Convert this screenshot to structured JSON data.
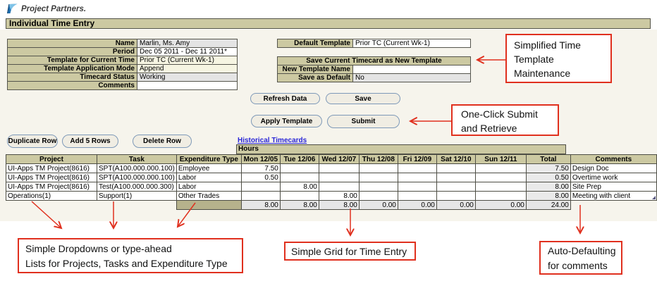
{
  "brand": {
    "name": "Project Partners.",
    "icon": "pennant-logo-icon"
  },
  "page": {
    "title": "Individual Time Entry"
  },
  "details_form": {
    "rows": [
      {
        "label": "Name",
        "value": "Marlin, Ms. Amy"
      },
      {
        "label": "Period",
        "value": "Dec 05 2011 - Dec 11 2011*"
      },
      {
        "label": "Template for Current Time",
        "value": "Prior TC (Current Wk-1)"
      },
      {
        "label": "Template Application Mode",
        "value": "Append"
      },
      {
        "label": "Timecard Status",
        "value": "Working"
      },
      {
        "label": "Comments",
        "value": ""
      }
    ]
  },
  "template_form": {
    "default_template_label": "Default Template",
    "default_template_value": "Prior TC (Current Wk-1)",
    "section_title": "Save Current Timecard as New Template",
    "new_template_label": "New Template Name",
    "new_template_value": "",
    "save_default_label": "Save as Default",
    "save_default_value": "No"
  },
  "actions": {
    "refresh": "Refresh Data",
    "save": "Save",
    "apply": "Apply Template",
    "submit": "Submit"
  },
  "row_actions": {
    "duplicate": "Duplicate Row",
    "add5": "Add 5 Rows",
    "delete": "Delete Row"
  },
  "link": {
    "historical": "Historical Timecards"
  },
  "timecard": {
    "hours_label": "Hours",
    "columns": [
      "Project",
      "Task",
      "Expenditure Type"
    ],
    "day_columns": [
      "Mon 12/05",
      "Tue 12/06",
      "Wed 12/07",
      "Thu 12/08",
      "Fri 12/09",
      "Sat 12/10",
      "Sun 12/11"
    ],
    "total_label": "Total",
    "comments_label": "Comments",
    "rows": [
      {
        "project": "UI-Apps TM Project(8616)",
        "task": "SPT(A100.000.000.100)",
        "expenditure_type": "Employee",
        "hours": [
          "7.50",
          "",
          "",
          "",
          "",
          "",
          ""
        ],
        "total": "7.50",
        "comments": "Design Doc"
      },
      {
        "project": "UI-Apps TM Project(8616)",
        "task": "SPT(A100.000.000.100)",
        "expenditure_type": "Labor",
        "hours": [
          "0.50",
          "",
          "",
          "",
          "",
          "",
          ""
        ],
        "total": "0.50",
        "comments": "Overtime work"
      },
      {
        "project": "UI-Apps TM Project(8616)",
        "task": "Test(A100.000.000.300)",
        "expenditure_type": "Labor",
        "hours": [
          "",
          "8.00",
          "",
          "",
          "",
          "",
          ""
        ],
        "total": "8.00",
        "comments": "Site Prep"
      },
      {
        "project": "Operations(1)",
        "task": "Support(1)",
        "expenditure_type": "Other Trades",
        "hours": [
          "",
          "",
          "8.00",
          "",
          "",
          "",
          ""
        ],
        "total": "8.00",
        "comments": "Meeting with client"
      }
    ],
    "totals": {
      "hours": [
        "8.00",
        "8.00",
        "8.00",
        "0.00",
        "0.00",
        "0.00",
        "0.00"
      ],
      "total": "24.00"
    }
  },
  "annotations": {
    "accent_color": "#e0301e",
    "notes": [
      {
        "id": "template-maintenance",
        "text": "Simplified Time\nTemplate\nMaintenance"
      },
      {
        "id": "one-click-submit",
        "text": "One-Click Submit\nand Retrieve"
      },
      {
        "id": "dropdowns",
        "text": "Simple Dropdowns  or type-ahead\nLists for Projects, Tasks and Expenditure Type"
      },
      {
        "id": "grid",
        "text": "Simple Grid for Time Entry"
      },
      {
        "id": "auto-default",
        "text": "Auto-Defaulting\nfor comments"
      }
    ]
  }
}
